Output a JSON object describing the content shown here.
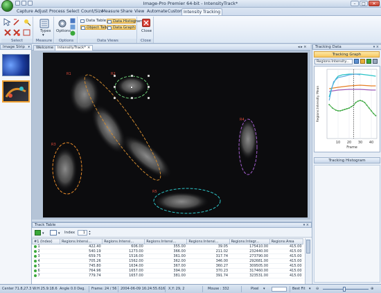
{
  "app": {
    "title": "Image-Pro Premier 64-bit - IntensityTrack*"
  },
  "window_buttons": {
    "minimize": "–",
    "maximize": "□",
    "close": "✕"
  },
  "tabs": [
    "Capture",
    "Adjust",
    "Process",
    "Select",
    "Count/Size",
    "Measure",
    "Share",
    "View",
    "Automate",
    "Custom",
    "Intensity Tracking"
  ],
  "active_tab": "Intensity Tracking",
  "ribbon": {
    "groups": {
      "select": "Select",
      "measure": "Measure",
      "options": "Options",
      "data_views": "Data Views",
      "close": "Close"
    },
    "types_label": "Types",
    "options_label": "Options",
    "data_table": "Data Table",
    "data_histogram": "Data Histogram",
    "object_table": "Object Table",
    "data_graph": "Data Graph",
    "close_label": "Close"
  },
  "image_strip": {
    "title": "Image Strip"
  },
  "documents": [
    {
      "label": "Welcome",
      "active": false
    },
    {
      "label": "IntensityTrack*",
      "active": true
    }
  ],
  "roi_labels": [
    "R1",
    "R2",
    "R3",
    "R4",
    "R5"
  ],
  "right_panel": {
    "title": "Tracking Data",
    "graph_tab": "Tracking Graph",
    "dropdown_value": "Regions:Intensity...",
    "histogram_tab": "Tracking Histogram"
  },
  "chart_data": {
    "type": "line",
    "title": "",
    "xlabel": "Frame",
    "ylabel": "Regions:Intensity Mean",
    "x_ticks": [
      "10",
      "20",
      "30",
      "40"
    ],
    "xlim": [
      0,
      45
    ],
    "series": [
      {
        "color": "#4caf50",
        "values": [
          [
            2,
            49
          ],
          [
            5,
            44
          ],
          [
            8,
            41
          ],
          [
            10,
            40
          ],
          [
            12,
            40
          ],
          [
            14,
            41
          ],
          [
            16,
            42
          ],
          [
            18,
            43
          ],
          [
            20,
            44
          ],
          [
            22,
            46
          ],
          [
            24,
            48
          ],
          [
            26,
            52
          ],
          [
            28,
            54
          ],
          [
            30,
            55
          ],
          [
            32,
            54
          ],
          [
            34,
            52
          ],
          [
            36,
            48
          ],
          [
            38,
            44
          ],
          [
            40,
            40
          ],
          [
            42,
            36
          ],
          [
            44,
            33
          ]
        ]
      },
      {
        "color": "#9b59b6",
        "values": [
          [
            2,
            68
          ],
          [
            10,
            70
          ],
          [
            20,
            71
          ],
          [
            30,
            71
          ],
          [
            40,
            70
          ],
          [
            44,
            70
          ]
        ]
      },
      {
        "color": "#e67e22",
        "values": [
          [
            2,
            72
          ],
          [
            10,
            74
          ],
          [
            20,
            76
          ],
          [
            30,
            77
          ],
          [
            40,
            76
          ],
          [
            44,
            76
          ]
        ]
      },
      {
        "color": "#27c3c7",
        "values": [
          [
            2,
            60
          ],
          [
            4,
            72
          ],
          [
            6,
            80
          ],
          [
            8,
            86
          ],
          [
            10,
            90
          ],
          [
            14,
            92
          ],
          [
            20,
            93
          ],
          [
            30,
            93
          ],
          [
            40,
            91
          ],
          [
            44,
            90
          ]
        ]
      },
      {
        "color": "#5dade2",
        "values": [
          [
            2,
            55
          ],
          [
            4,
            70
          ],
          [
            6,
            82
          ],
          [
            10,
            88
          ],
          [
            16,
            90
          ],
          [
            20,
            92
          ],
          [
            26,
            93
          ],
          [
            30,
            92
          ]
        ]
      }
    ]
  },
  "track_table": {
    "title": "Track Table",
    "index_label": "Index",
    "index_value": "1",
    "columns": [
      "#1 (Index)",
      "Regions:Intensi...",
      "Regions:Intensi...",
      "Regions:Intensi...",
      "Regions:Intensi...",
      "Regions:Integr...",
      "Regions:Area"
    ],
    "rows": [
      [
        "1",
        "422.40",
        "606.00",
        "355.00",
        "39.05",
        "175410.00",
        "415.00"
      ],
      [
        "2",
        "540.19",
        "1273.00",
        "366.00",
        "211.02",
        "232440.00",
        "415.00"
      ],
      [
        "3",
        "659.75",
        "1516.00",
        "361.00",
        "317.74",
        "273790.00",
        "415.00"
      ],
      [
        "4",
        "705.26",
        "1562.00",
        "362.00",
        "346.00",
        "292681.00",
        "415.00"
      ],
      [
        "5",
        "745.80",
        "1634.00",
        "367.00",
        "360.27",
        "309505.00",
        "415.00"
      ],
      [
        "6",
        "764.96",
        "1657.00",
        "394.00",
        "370.23",
        "317460.00",
        "415.00"
      ],
      [
        "7",
        "779.74",
        "1657.00",
        "381.00",
        "391.74",
        "323531.00",
        "415.00"
      ]
    ]
  },
  "status": {
    "center": "Center 71.8,27.3",
    "wh": "W:H 25.9:18.6",
    "angle": "Angle 0.0 Deg.",
    "frame": "Frame: 24 / 56",
    "timestamp": "2004-06-09 16:24:55.616",
    "xy": "X,Y: 29, 2",
    "mouse": "Mouse : 332",
    "unit": "Pixel",
    "fit": "Best Fit"
  }
}
